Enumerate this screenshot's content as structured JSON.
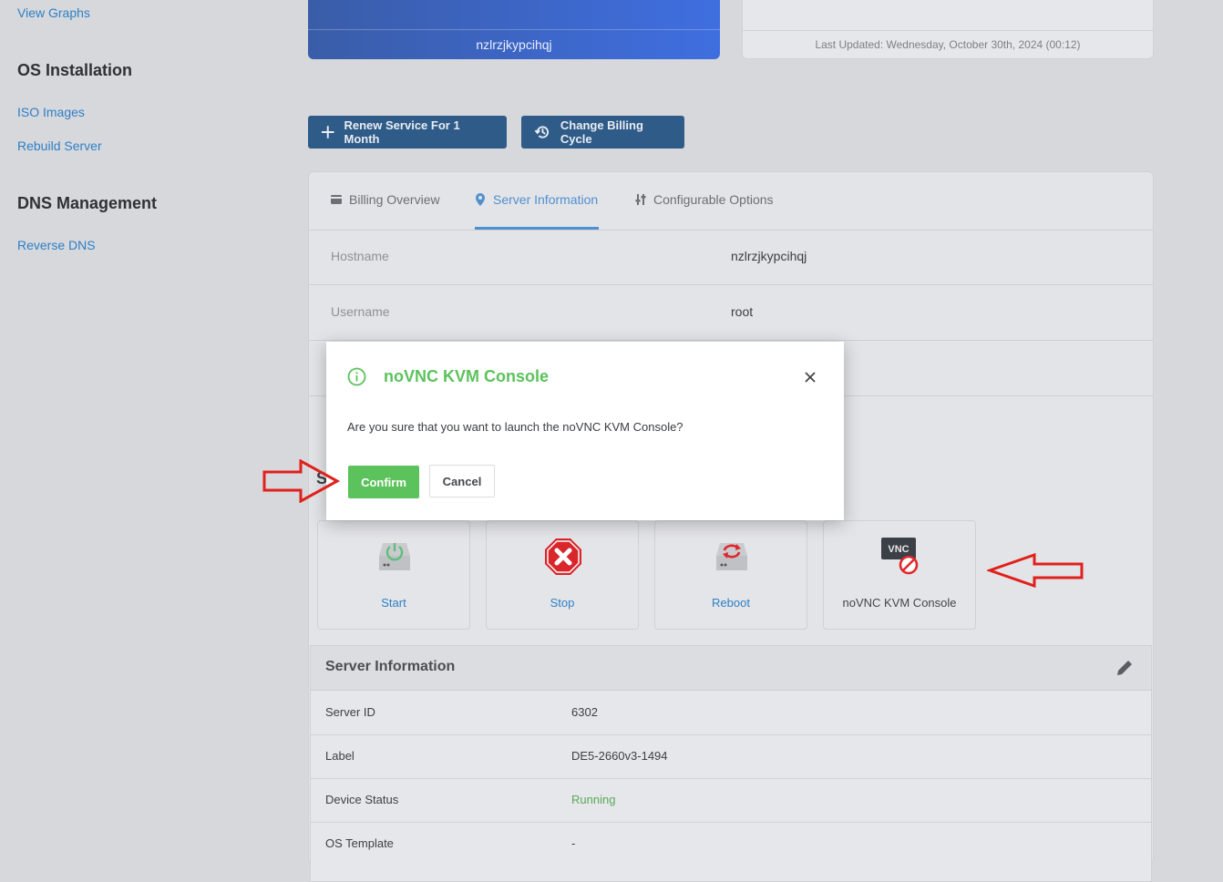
{
  "sidebar": {
    "view_graphs": "View Graphs",
    "os_installation": "OS Installation",
    "iso_images": "ISO Images",
    "rebuild_server": "Rebuild Server",
    "dns_management": "DNS Management",
    "reverse_dns": "Reverse DNS"
  },
  "host_card": {
    "hostname": "nzlrzjkypcihqj"
  },
  "update_card": {
    "last_updated": "Last Updated: Wednesday, October 30th, 2024 (00:12)"
  },
  "actions": {
    "renew": "Renew Service For 1 Month",
    "change_billing": "Change Billing Cycle"
  },
  "tabs": [
    {
      "label": "Billing Overview",
      "icon": "billing-icon"
    },
    {
      "label": "Server Information",
      "icon": "location-pin-icon",
      "active": true
    },
    {
      "label": "Configurable Options",
      "icon": "sliders-icon"
    }
  ],
  "server_info_rows": [
    {
      "label": "Hostname",
      "value": "nzlrzjkypcihqj"
    },
    {
      "label": "Username",
      "value": "root"
    }
  ],
  "section_letter": "S",
  "controls": [
    {
      "label": "Start",
      "icon": "power-drive-icon"
    },
    {
      "label": "Stop",
      "icon": "stop-x-icon"
    },
    {
      "label": "Reboot",
      "icon": "reboot-drive-icon"
    },
    {
      "label": "noVNC KVM Console",
      "icon": "vnc-disabled-icon"
    }
  ],
  "server_card": {
    "title": "Server Information",
    "rows": [
      {
        "label": "Server ID",
        "value": "6302"
      },
      {
        "label": "Label",
        "value": "DE5-2660v3-1494"
      },
      {
        "label": "Device Status",
        "value": "Running"
      },
      {
        "label": "OS Template",
        "value": "-"
      }
    ]
  },
  "modal": {
    "title": "noVNC KVM Console",
    "message": "Are you sure that you want to launch the noVNC KVM Console?",
    "confirm": "Confirm",
    "cancel": "Cancel",
    "vnc_badge": "VNC"
  },
  "colors": {
    "accent_blue": "#2d7fc6",
    "confirm_green": "#5cc25c",
    "dark_button": "#2f5b88",
    "running_green": "#5aa85a",
    "annotation_red": "#e0201c"
  }
}
